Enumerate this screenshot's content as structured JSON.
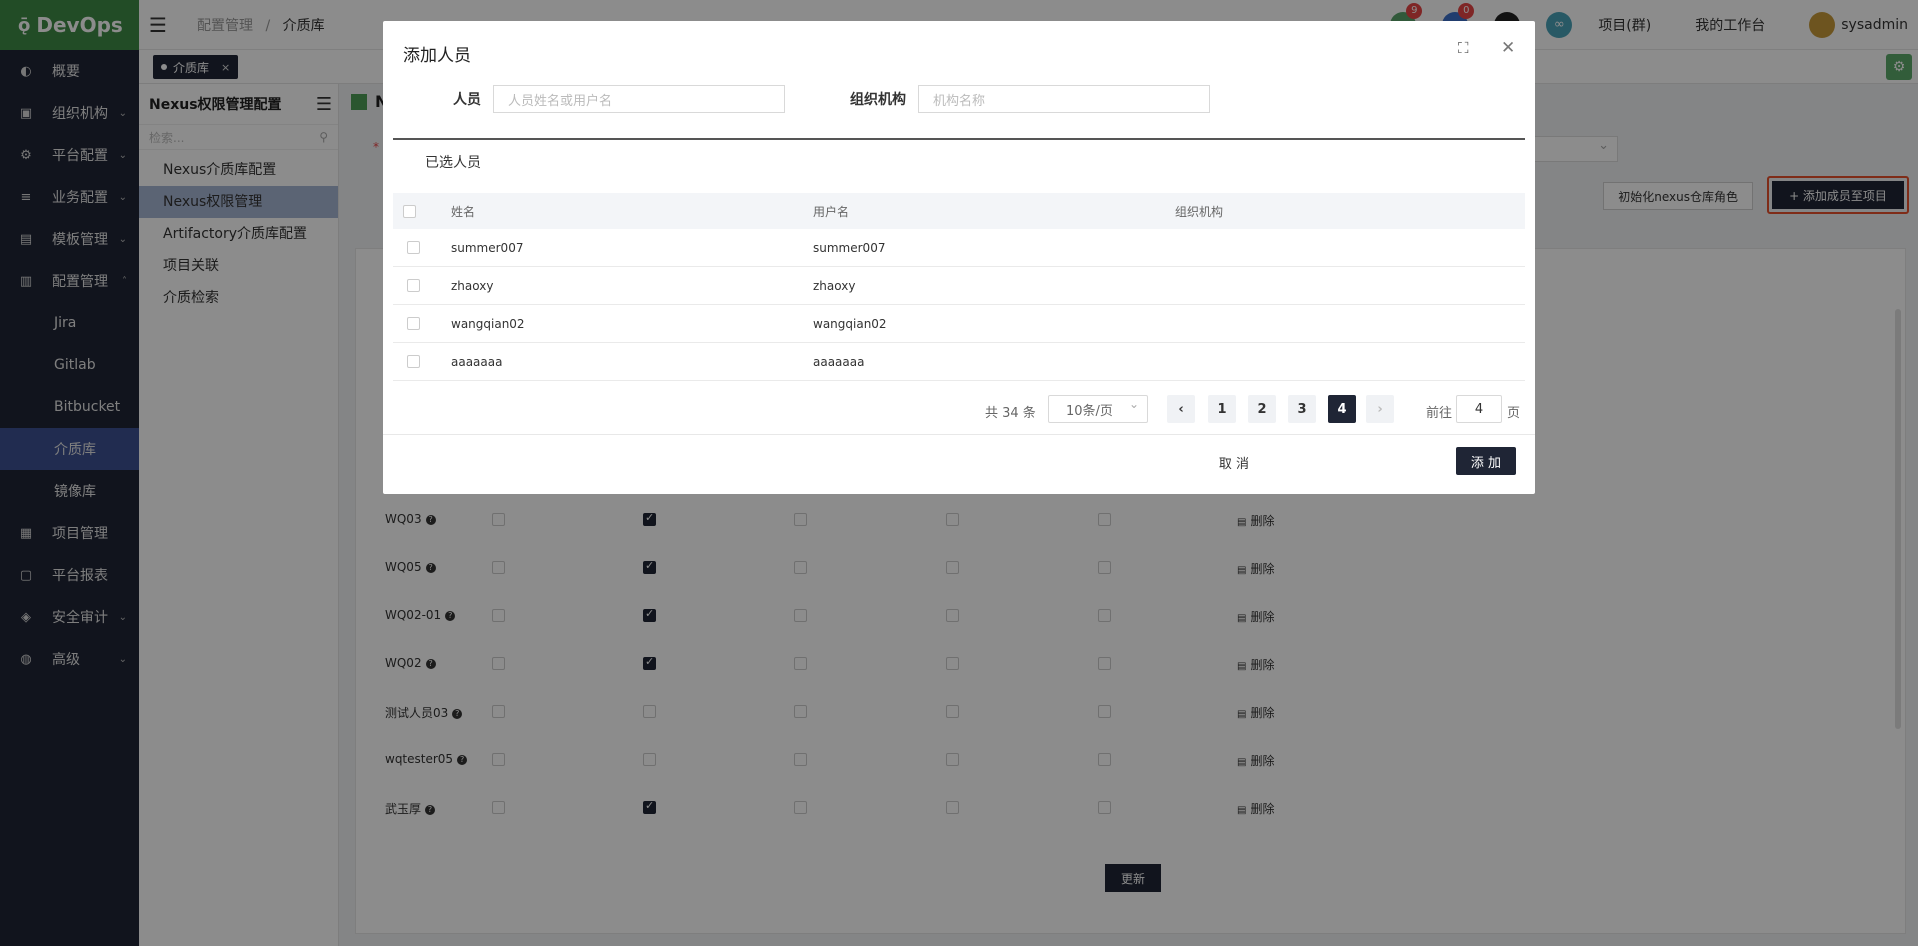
{
  "brand": {
    "name": "DevOps",
    "logo_glyph": "ǭ"
  },
  "sidebar": {
    "items": [
      {
        "label": "概要",
        "icon": "dashboard-icon",
        "glyph": "◐",
        "caret": ""
      },
      {
        "label": "组织机构",
        "icon": "lock-icon",
        "glyph": "▣",
        "caret": "⌄"
      },
      {
        "label": "平台配置",
        "icon": "gear-icon",
        "glyph": "⚙",
        "caret": "⌄"
      },
      {
        "label": "业务配置",
        "icon": "sliders-icon",
        "glyph": "≡",
        "caret": "⌄"
      },
      {
        "label": "模板管理",
        "icon": "template-icon",
        "glyph": "▤",
        "caret": "⌄"
      },
      {
        "label": "配置管理",
        "icon": "database-icon",
        "glyph": "▥",
        "caret": "˄"
      }
    ],
    "sub_items": [
      "Jira",
      "Gitlab",
      "Bitbucket",
      "介质库",
      "镜像库"
    ],
    "bottom_items": [
      {
        "label": "项目管理",
        "icon": "apps-icon",
        "glyph": "▦",
        "caret": ""
      },
      {
        "label": "平台报表",
        "icon": "monitor-icon",
        "glyph": "▢",
        "caret": ""
      },
      {
        "label": "安全审计",
        "icon": "shield-icon",
        "glyph": "◈",
        "caret": "⌄"
      },
      {
        "label": "高级",
        "icon": "palette-icon",
        "glyph": "◍",
        "caret": "⌄"
      }
    ]
  },
  "header": {
    "breadcrumb": [
      "配置管理",
      "介质库"
    ],
    "breadcrumb_sep": "/",
    "badges": [
      "9",
      "0"
    ],
    "project_link": "项目(群)",
    "workbench_link": "我的工作台",
    "username": "sysadmin"
  },
  "tagbar": {
    "tag_label": "介质库",
    "close": "×"
  },
  "subnav": {
    "title": "Nexus权限管理配置",
    "search_placeholder": "检索...",
    "items": [
      "Nexus介质库配置",
      "Nexus权限管理",
      "Artifactory介质库配置",
      "项目关联",
      "介质检索"
    ]
  },
  "main": {
    "title_partial": "N",
    "init_button": "初始化nexus仓库角色",
    "add_member_button": "+ 添加成员至项目",
    "rows": [
      {
        "name": "WQ03",
        "checks": [
          false,
          true,
          false,
          false,
          false
        ]
      },
      {
        "name": "WQ05",
        "checks": [
          false,
          true,
          false,
          false,
          false
        ]
      },
      {
        "name": "WQ02-01",
        "checks": [
          false,
          true,
          false,
          false,
          false
        ]
      },
      {
        "name": "WQ02",
        "checks": [
          false,
          true,
          false,
          false,
          false
        ]
      },
      {
        "name": "测试人员03",
        "checks": [
          false,
          false,
          false,
          false,
          false
        ]
      },
      {
        "name": "wqtester05",
        "checks": [
          false,
          false,
          false,
          false,
          false
        ]
      },
      {
        "name": "武玉厚",
        "checks": [
          false,
          true,
          false,
          false,
          false
        ]
      }
    ],
    "delete_label": "删除",
    "delete_icon": "▤",
    "update_button": "更新"
  },
  "modal": {
    "title": "添加人员",
    "person_label": "人员",
    "person_placeholder": "人员姓名或用户名",
    "org_label": "组织机构",
    "org_placeholder": "机构名称",
    "selected_title": "已选人员",
    "columns": [
      "姓名",
      "用户名",
      "组织机构"
    ],
    "rows": [
      {
        "name": "summer007",
        "username": "summer007",
        "org": ""
      },
      {
        "name": "zhaoxy",
        "username": "zhaoxy",
        "org": ""
      },
      {
        "name": "wangqian02",
        "username": "wangqian02",
        "org": ""
      },
      {
        "name": "aaaaaaa",
        "username": "aaaaaaa",
        "org": ""
      }
    ],
    "pagination": {
      "total_text": "共 34 条",
      "page_size": "10条/页",
      "prev": "‹",
      "pages": [
        "1",
        "2",
        "3",
        "4"
      ],
      "current_page": "4",
      "next": "›",
      "goto_label": "前往",
      "goto_value": "4",
      "page_suffix": "页"
    },
    "cancel_button": "取 消",
    "add_button": "添 加"
  },
  "colors": {
    "brand_green": "#3f8b45",
    "sidebar_bg": "#1f2535",
    "active_blue": "#3c5193",
    "highlight_red": "#e8502c"
  }
}
